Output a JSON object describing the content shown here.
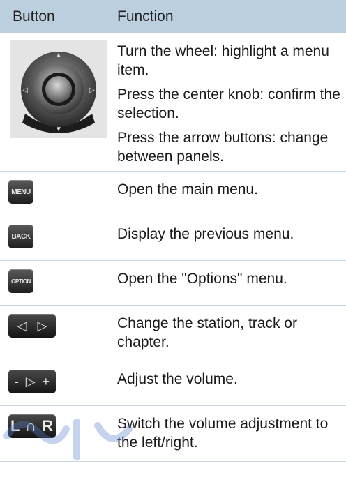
{
  "header": {
    "col_button": "Button",
    "col_function": "Function"
  },
  "controller": {
    "icon": "idrive-controller-icon",
    "lines": [
      "Turn the wheel: highlight a menu item.",
      "Press the center knob: confirm the selection.",
      "Press the arrow buttons: change between panels."
    ]
  },
  "rows": [
    {
      "button_label": "MENU",
      "icon": "menu-button-icon",
      "function": "Open the main menu."
    },
    {
      "button_label": "BACK",
      "icon": "back-button-icon",
      "function": "Display the previous menu."
    },
    {
      "button_label": "OPTION",
      "icon": "option-button-icon",
      "function": "Open the \"Options\" menu."
    },
    {
      "button_label": "◁   ▷",
      "icon": "track-arrows-icon",
      "function": "Change the station, track or chapter."
    },
    {
      "button_label": "-  ▷  +",
      "icon": "volume-rocker-icon",
      "function": "Adjust the volume."
    },
    {
      "button_label": "L ∩ R",
      "icon": "balance-lr-icon",
      "function": "Switch the volume adjustment to the left/right."
    }
  ],
  "colors": {
    "header_bg": "#bccfdf",
    "divider": "#c9d6e2",
    "button_bg": "#2a2a2a"
  }
}
